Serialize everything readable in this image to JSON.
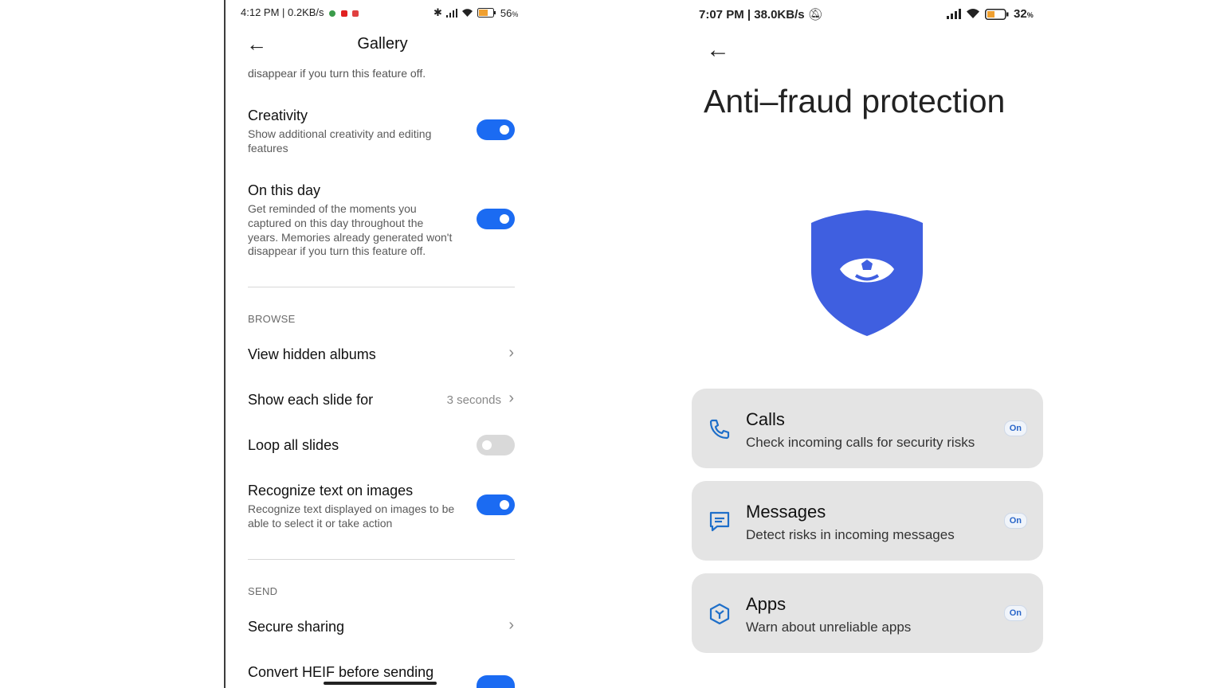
{
  "left": {
    "status": {
      "time_speed": "4:12 PM | 0.2KB/s",
      "battery": "56"
    },
    "header": {
      "back_icon": "←",
      "title": "Gallery"
    },
    "truncated_text": "disappear if you turn this feature off.",
    "settings": {
      "creativity": {
        "title": "Creativity",
        "desc_1": "Show additional creativity and editing",
        "desc_2": "features",
        "enabled": true
      },
      "on_this_day": {
        "title": "On this day",
        "desc_1": "Get reminded of the moments you",
        "desc_2": "captured on this day throughout the",
        "desc_3": "years. Memories already generated won't",
        "desc_4": "disappear if you turn this feature off.",
        "enabled": true
      }
    },
    "browse": {
      "label": "BROWSE",
      "view_hidden_albums": "View hidden albums",
      "show_each_slide": {
        "title": "Show each slide for",
        "value": "3 seconds"
      },
      "loop_all_slides": {
        "title": "Loop all slides",
        "enabled": false
      },
      "recognize_text": {
        "title": "Recognize text on images",
        "desc_1": "Recognize text displayed on images to be",
        "desc_2": "able to select it or take action",
        "enabled": true
      }
    },
    "send": {
      "label": "SEND",
      "secure_sharing": "Secure sharing",
      "convert_heif": "Convert HEIF before sending"
    },
    "colors": {
      "accent": "#1b6bf2",
      "toggle_off": "#d9d9d9"
    }
  },
  "right": {
    "status": {
      "time_speed": "7:07 PM | 38.0KB/s",
      "battery": "32"
    },
    "back_icon": "←",
    "title": "Anti–fraud protection",
    "shield_color": "#3f5fe0",
    "cards": [
      {
        "icon": "phone-icon",
        "title": "Calls",
        "desc": "Check incoming calls for security risks",
        "badge": "On"
      },
      {
        "icon": "message-icon",
        "title": "Messages",
        "desc": "Detect risks in incoming messages",
        "badge": "On"
      },
      {
        "icon": "app-shield-icon",
        "title": "Apps",
        "desc": "Warn about unreliable apps",
        "badge": "On"
      }
    ]
  }
}
